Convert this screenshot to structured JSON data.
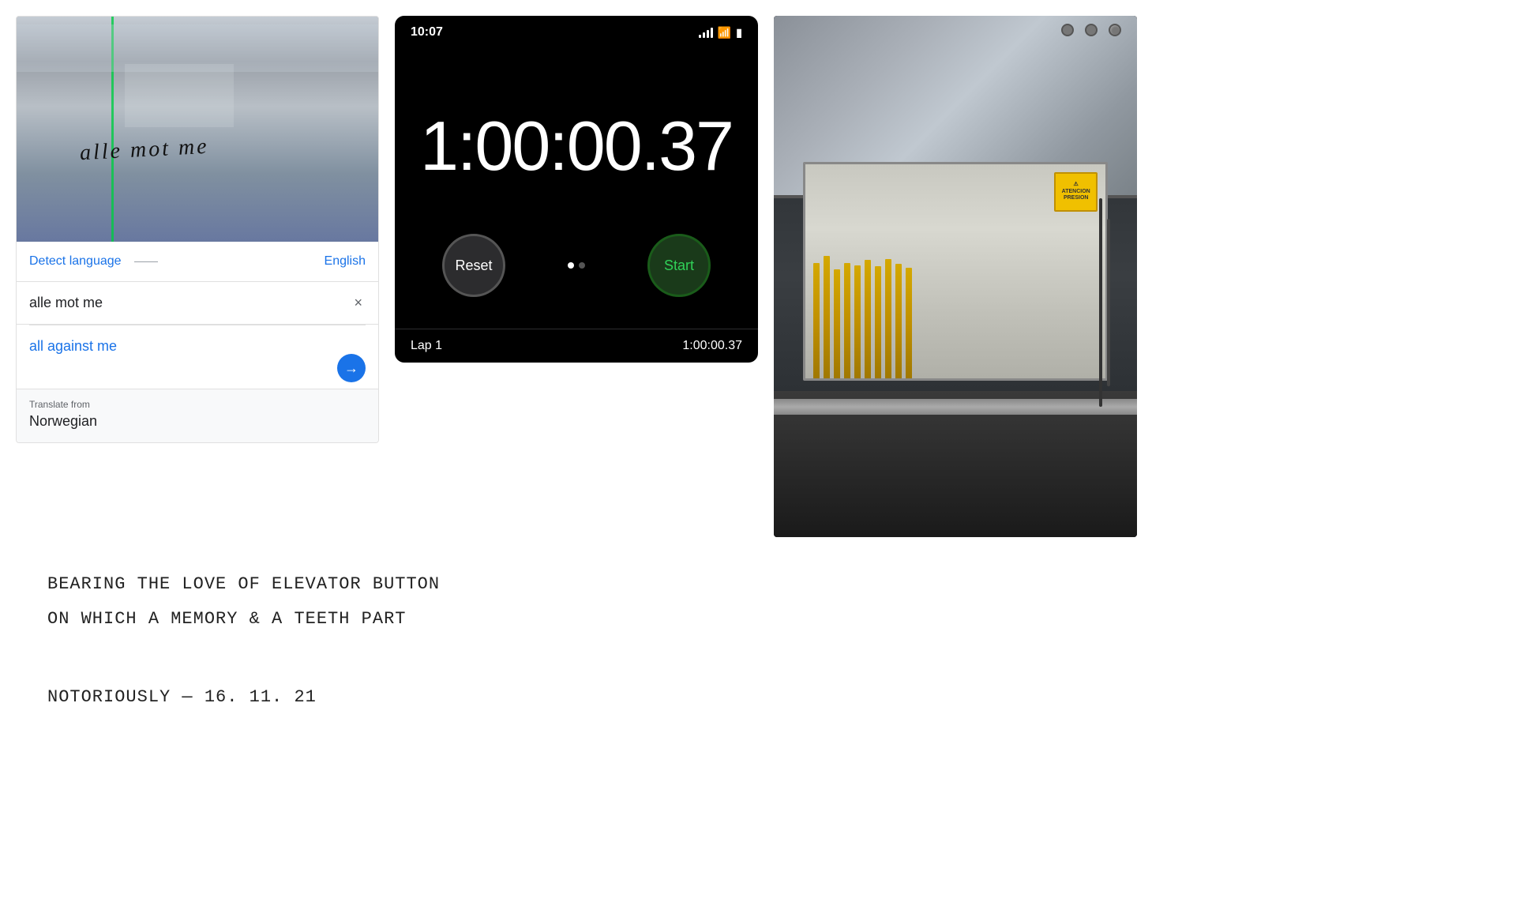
{
  "translate": {
    "detect_language_label": "Detect language",
    "target_language": "English",
    "input_text": "alle mot me",
    "translated_text": "all against me",
    "from_label": "Translate from",
    "from_language": "Norwegian",
    "clear_button_label": "×",
    "forward_arrow": "→"
  },
  "stopwatch": {
    "time_label": "10:07",
    "elapsed_time": "1:00:00.37",
    "reset_button": "Reset",
    "start_button": "Start",
    "lap_label": "Lap 1",
    "lap_time": "1:00:00.37"
  },
  "handwritten": {
    "line1": "BEARING THE LOVE OF ELEVATOR BUTTON",
    "line2": "ON WHICH A MEMORY & A TEETH PART",
    "line3": "",
    "line4": "NOTORIOUSLY — 16. 11. 21"
  },
  "colors": {
    "blue": "#1a73e8",
    "black": "#000000",
    "green_btn": "#1a3a1a",
    "green_text": "#30d158",
    "white": "#ffffff",
    "gray_bg": "#f8f9fa"
  }
}
